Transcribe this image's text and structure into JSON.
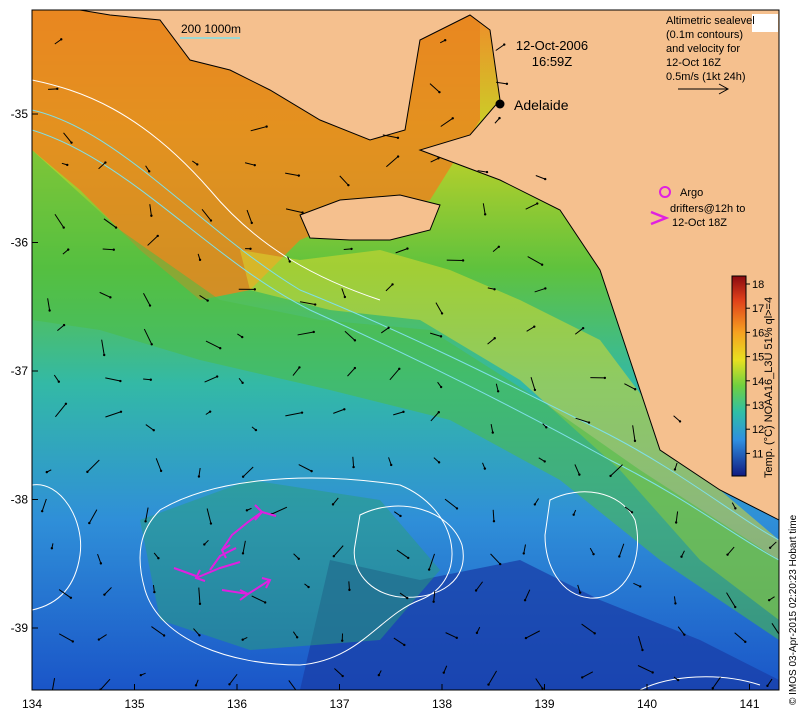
{
  "map": {
    "date": "12-Oct-2006",
    "time": "16:59Z",
    "place_label": "Adelaide",
    "scale_label": "200 1000m",
    "legend_text": [
      "Altimetric sealevel",
      "(0.1m contours)",
      "and velocity for",
      "12-Oct 16Z",
      "0.5m/s (1kt 24h)"
    ],
    "argo_text": [
      "Argo",
      "drifters@12h to",
      "12-Oct 18Z"
    ],
    "colorbar_title": "Temp. (°C) NOAA16_L3U 51% ql>=4",
    "colorbar_ticks": [
      "18",
      "17",
      "16",
      "15",
      "14",
      "13",
      "12",
      "11"
    ],
    "credit": "© IMOS 03-Apr-2015 02:20:23 Hobart time",
    "x_ticks": [
      "134",
      "135",
      "136",
      "137",
      "138",
      "139",
      "140",
      "141"
    ],
    "y_ticks": [
      "-35",
      "-36",
      "-37",
      "-38",
      "-39"
    ],
    "colors": {
      "land": "#f5c08e",
      "warm": "#e8741c",
      "mid": "#7ccf3a",
      "cool": "#2fb6b0",
      "cold": "#1d64d8",
      "contour": "#ffffff",
      "isobath": "#7fe0e8",
      "drifter": "#e020e0"
    }
  }
}
